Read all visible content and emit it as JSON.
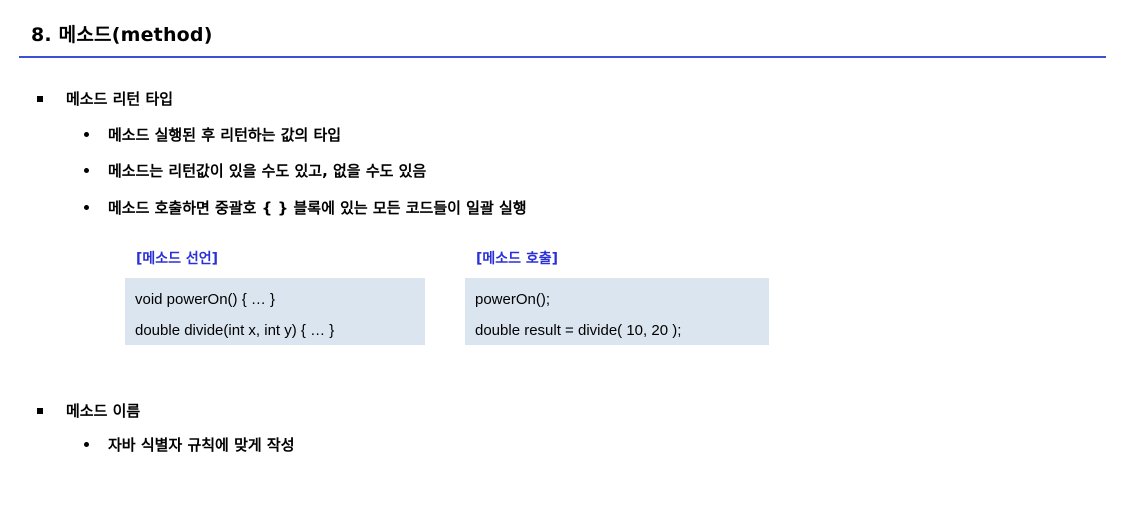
{
  "title": "8. 메소드(method)",
  "colors": {
    "rule": "#3f4fd1",
    "code_label": "#2b2fd8",
    "code_bg": "#dbe5ef"
  },
  "sections": [
    {
      "heading": "메소드 리턴 타입",
      "bullets": [
        "메소드 실행된 후 리턴하는 값의 타입",
        "메소드는 리턴값이 있을 수도 있고, 없을 수도 있음",
        "메소드 호출하면 중괄호 { } 블록에 있는 모든 코드들이 일괄 실행"
      ]
    },
    {
      "heading": "메소드 이름",
      "bullets": [
        "자바 식별자 규칙에 맞게 작성"
      ]
    }
  ],
  "code_blocks": [
    {
      "label": "[메소드 선언]",
      "lines": [
        "void powerOn() { … }",
        "double divide(int x, int y) { … }"
      ]
    },
    {
      "label": "[메소드 호출]",
      "lines": [
        "powerOn();",
        "double result = divide( 10, 20 );"
      ]
    }
  ]
}
